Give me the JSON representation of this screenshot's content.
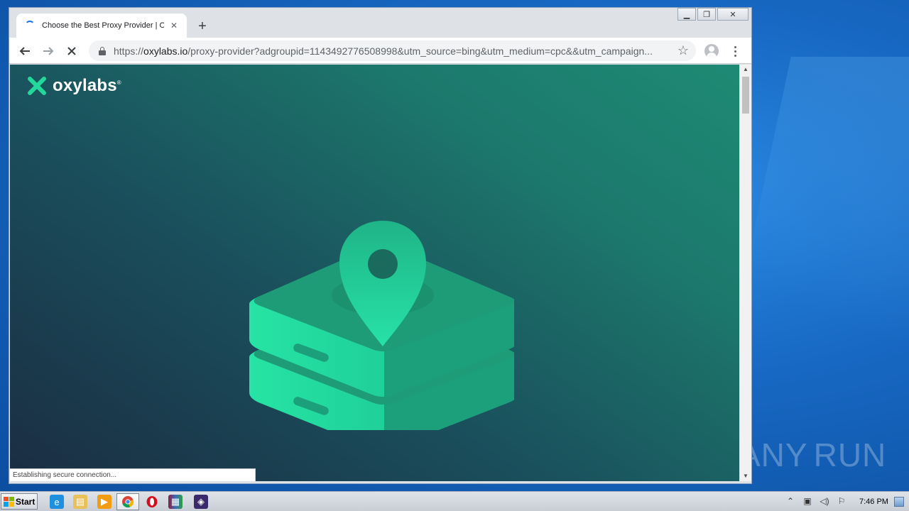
{
  "browser": {
    "tab": {
      "title": "Choose the Best Proxy Provider | Ox",
      "close_glyph": "✕"
    },
    "new_tab_glyph": "+",
    "url": {
      "scheme": "https://",
      "host": "oxylabs.io",
      "path": "/proxy-provider?adgroupid=1143492776508998&utm_source=bing&utm_medium=cpc&&utm_campaign..."
    },
    "status_text": "Establishing secure connection...",
    "window_controls": {
      "minimize": "▁",
      "restore": "❐",
      "close": "✕"
    }
  },
  "page": {
    "logo_text": "oxylabs",
    "logo_mark": "®",
    "brand_color": "#23d89a"
  },
  "taskbar": {
    "start_label": "Start",
    "clock": "7:46 PM",
    "pinned": [
      "ie-icon",
      "explorer-icon",
      "media-player-icon",
      "chrome-icon",
      "opera-icon",
      "winrar-icon",
      "app-icon"
    ]
  },
  "watermark": {
    "text_left": "ANY",
    "text_right": "RUN"
  }
}
